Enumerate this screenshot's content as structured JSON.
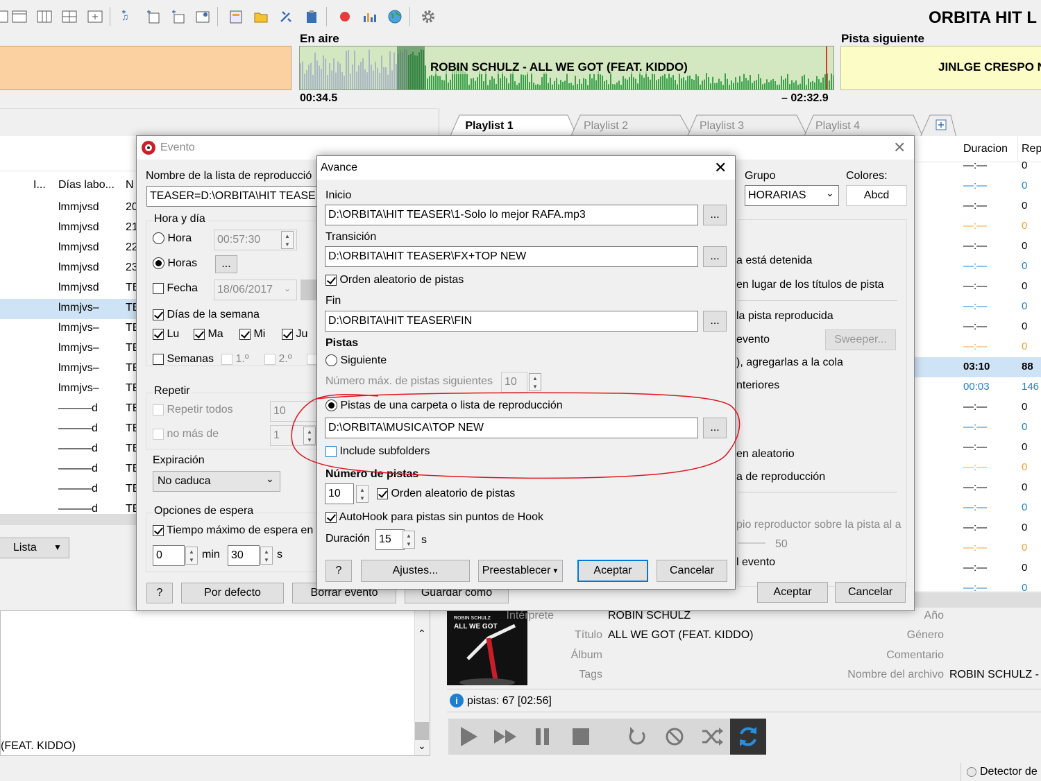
{
  "app": {
    "title": "ORBITA HIT L"
  },
  "onair": {
    "label": "En aire",
    "track": "ROBIN SCHULZ - ALL WE GOT (FEAT. KIDDO)",
    "elapsed": "00:34.5",
    "remaining": "– 02:32.9",
    "progress": 0.2
  },
  "next": {
    "label": "Pista siguiente",
    "track": "JINLGE CRESPO N"
  },
  "playlist_tabs": [
    "Playlist 1",
    "Playlist 2",
    "Playlist 3",
    "Playlist 4"
  ],
  "left_table": {
    "headers": [
      "I...",
      "Días labo...",
      "N"
    ],
    "rows": [
      {
        "days": "lmmjvsd",
        "n": "20"
      },
      {
        "days": "lmmjvsd",
        "n": "21"
      },
      {
        "days": "lmmjvsd",
        "n": "22"
      },
      {
        "days": "lmmjvsd",
        "n": "23"
      },
      {
        "days": "lmmjvsd",
        "n": "TE"
      },
      {
        "days": "lmmjvs–",
        "n": "TE"
      },
      {
        "days": "lmmjvs–",
        "n": "TE"
      },
      {
        "days": "lmmjvs–",
        "n": "TE"
      },
      {
        "days": "lmmjvs–",
        "n": "TE"
      },
      {
        "days": "lmmjvs–",
        "n": "TE"
      },
      {
        "days": "———d",
        "n": "TE"
      },
      {
        "days": "———d",
        "n": "TE"
      },
      {
        "days": "———d",
        "n": "TE"
      },
      {
        "days": "———d",
        "n": "TE"
      },
      {
        "days": "———d",
        "n": "TE"
      },
      {
        "days": "———d",
        "n": "TE"
      }
    ],
    "view_select": "Lista",
    "bottom_text": "(FEAT. KIDDO)"
  },
  "right_table": {
    "headers": [
      "Duracion",
      "Rep"
    ],
    "rows": [
      {
        "dur": "—:—",
        "rep": "0",
        "c": "black"
      },
      {
        "dur": "—:—",
        "rep": "0",
        "c": "blue"
      },
      {
        "dur": "—:—",
        "rep": "0",
        "c": "black"
      },
      {
        "dur": "—:—",
        "rep": "0",
        "c": "orange"
      },
      {
        "dur": "—:—",
        "rep": "0",
        "c": "black"
      },
      {
        "dur": "—:—",
        "rep": "0",
        "c": "blue"
      },
      {
        "dur": "—:—",
        "rep": "0",
        "c": "black"
      },
      {
        "dur": "—:—",
        "rep": "0",
        "c": "blue"
      },
      {
        "dur": "—:—",
        "rep": "0",
        "c": "black"
      },
      {
        "dur": "—:—",
        "rep": "0",
        "c": "orange"
      },
      {
        "dur": "03:10",
        "rep": "88",
        "c": "selected"
      },
      {
        "dur": "00:03",
        "rep": "146",
        "c": "blue"
      },
      {
        "dur": "—:—",
        "rep": "0",
        "c": "black"
      },
      {
        "dur": "—:—",
        "rep": "0",
        "c": "blue"
      },
      {
        "dur": "—:—",
        "rep": "0",
        "c": "black"
      },
      {
        "dur": "—:—",
        "rep": "0",
        "c": "orange"
      },
      {
        "dur": "—:—",
        "rep": "0",
        "c": "black"
      },
      {
        "dur": "—:—",
        "rep": "0",
        "c": "blue"
      },
      {
        "dur": "—:—",
        "rep": "0",
        "c": "black"
      },
      {
        "dur": "—:—",
        "rep": "0",
        "c": "orange"
      },
      {
        "dur": "—:—",
        "rep": "0",
        "c": "black"
      },
      {
        "dur": "—:—",
        "rep": "0",
        "c": "blue"
      }
    ]
  },
  "track_info": {
    "interprete_label": "Intérprete",
    "interprete": "ROBIN SCHULZ",
    "titulo_label": "Título",
    "titulo": "ALL WE GOT (FEAT. KIDDO)",
    "album_label": "Álbum",
    "tags_label": "Tags",
    "ano_label": "Año",
    "genero_label": "Género",
    "comentario_label": "Comentario",
    "archivo_label": "Nombre del archivo",
    "archivo": "ROBIN SCHULZ -",
    "cover_text": "ALL WE GOT",
    "cover_artist": "ROBIN SCHULZ",
    "pistas": "pistas: 67 [02:56]",
    "detector": "Detector de"
  },
  "evento": {
    "title": "Evento",
    "nombre_label": "Nombre de la lista de reproducció",
    "nombre_value": "TEASER=D:\\ORBITA\\HIT TEASER\\",
    "hora_dia": "Hora y día",
    "hora": "Hora",
    "hora_value": "00:57:30",
    "horas": "Horas",
    "horas_btn": "...",
    "fecha": "Fecha",
    "fecha_value": "18/06/2017",
    "dias_semana": "Días de la semana",
    "days": [
      "Lu",
      "Ma",
      "Mi",
      "Ju"
    ],
    "semanas": "Semanas",
    "w1": "1.º",
    "w2": "2.º",
    "repetir": "Repetir",
    "repetir_todos": "Repetir todos",
    "repetir_todos_val": "10",
    "no_mas_de": "no más de",
    "no_mas_de_val": "1",
    "expiracion": "Expiración",
    "expiracion_value": "No caduca",
    "opciones_espera": "Opciones de espera",
    "tiempo_max": "Tiempo máximo de espera en",
    "min_val": "0",
    "min_label": "min",
    "s_val": "30",
    "s_label": "s",
    "grupo_label": "Grupo",
    "grupo_value": "HORARIAS",
    "colores_label": "Colores:",
    "colores_value": "Abcd",
    "r1": "a está detenida",
    "r2": "en lugar de los títulos de pista",
    "r3": "la pista reproducida",
    "r4": "evento",
    "sweeper": "Sweeper...",
    "r5": "), agregarlas a la cola",
    "r6": "nteriores",
    "r7": "en aleatorio",
    "r8": "a de reproducción",
    "r9": "pio reproductor sobre la pista al a",
    "r9val": "50",
    "r10": "l evento",
    "help": "?",
    "por_defecto": "Por defecto",
    "borrar": "Borrar evento",
    "guardar": "Guardar como",
    "aceptar": "Aceptar",
    "cancelar": "Cancelar"
  },
  "avance": {
    "title": "Avance",
    "inicio_label": "Inicio",
    "inicio_value": "D:\\ORBITA\\HIT TEASER\\1-Solo lo mejor RAFA.mp3",
    "transicion_label": "Transición",
    "transicion_value": "D:\\ORBITA\\HIT TEASER\\FX+TOP NEW",
    "orden1": "Orden aleatorio de pistas",
    "fin_label": "Fin",
    "fin_value": "D:\\ORBITA\\HIT TEASER\\FIN",
    "pistas_label": "Pistas",
    "siguiente": "Siguiente",
    "num_max": "Número máx. de pistas siguientes",
    "num_max_val": "10",
    "carpeta": "Pistas de una carpeta o lista de reproducción",
    "carpeta_value": "D:\\ORBITA\\MUSICA\\TOP NEW",
    "subfolders": "Include subfolders",
    "numero_pistas": "Número de pistas",
    "numero_val": "10",
    "orden2": "Orden aleatorio de pistas",
    "autohook": "AutoHook para pistas sin puntos de Hook",
    "duracion_label": "Duración",
    "duracion_val": "15",
    "duracion_unit": "s",
    "browse": "...",
    "help": "?",
    "ajustes": "Ajustes...",
    "preestablecer": "Preestablecer",
    "aceptar": "Aceptar",
    "cancelar": "Cancelar"
  },
  "colors": {
    "onair_bg": "#d3e8c0",
    "wave_green": "#3aa14a",
    "left_panel": "#fbd1a2",
    "next_panel": "#fcfcc6",
    "selection": "#cfe3f6",
    "annotation": "#e0141e"
  }
}
